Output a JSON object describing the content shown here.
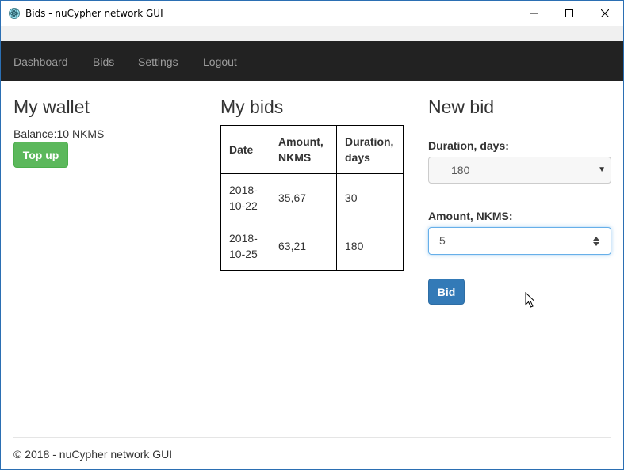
{
  "window": {
    "title": "Bids - nuCypher network GUI",
    "icon": "electron-icon",
    "controls": [
      "minimize-icon",
      "maximize-icon",
      "close-icon"
    ]
  },
  "navbar": {
    "items": [
      {
        "label": "Dashboard"
      },
      {
        "label": "Bids"
      },
      {
        "label": "Settings"
      },
      {
        "label": "Logout"
      }
    ]
  },
  "wallet": {
    "heading": "My wallet",
    "balance": "Balance:10 NKMS",
    "topup_label": "Top up"
  },
  "bids": {
    "heading": "My bids",
    "columns": [
      "Date",
      "Amount, NKMS",
      "Duration, days"
    ],
    "rows": [
      {
        "date": "2018-10-22",
        "amount": "35,67",
        "duration": "30"
      },
      {
        "date": "2018-10-25",
        "amount": "63,21",
        "duration": "180"
      }
    ]
  },
  "new_bid": {
    "heading": "New bid",
    "duration_label": "Duration, days:",
    "duration_value": "180",
    "amount_label": "Amount, NKMS:",
    "amount_value": "5",
    "bid_label": "Bid"
  },
  "footer": {
    "text": "© 2018 - nuCypher network GUI"
  },
  "colors": {
    "navbar_bg": "#222222",
    "nav_text": "#9d9d9d",
    "success": "#5cb85c",
    "primary": "#337ab7"
  }
}
